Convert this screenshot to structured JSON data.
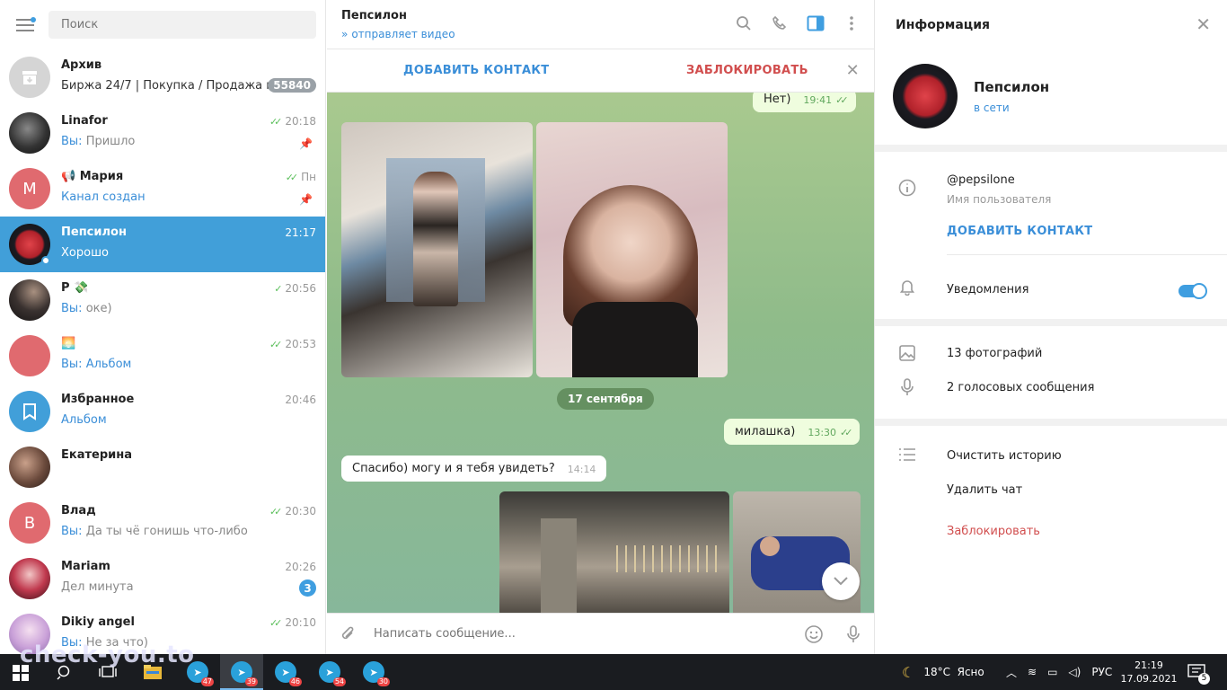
{
  "sidebar": {
    "search_placeholder": "Поиск",
    "chats": [
      {
        "name": "Архив",
        "preview": "Биржа 24/7 | Покупка / Продажа к...",
        "badge": "55840"
      },
      {
        "name": "Linafor",
        "time": "20:18",
        "you": "Вы:",
        "preview": " Пришло"
      },
      {
        "name": "📢 Мария",
        "time": "Пн",
        "avatar_letter": "М",
        "preview": "Канал создан"
      },
      {
        "name": "Пепсилон",
        "time": "21:17",
        "preview": "Хорошо"
      },
      {
        "name": "Р 💸",
        "time": "20:56",
        "you": "Вы:",
        "preview": " оке)"
      },
      {
        "name": "🌅",
        "time": "20:53",
        "you": "Вы:",
        "preview": " Альбом"
      },
      {
        "name": "Избранное",
        "time": "20:46",
        "preview": "Альбом"
      },
      {
        "name": "Екатерина",
        "time": "",
        "preview": ""
      },
      {
        "name": "Влад",
        "time": "20:30",
        "avatar_letter": "В",
        "you": "Вы:",
        "preview": " Да ты чё гонишь что-либо"
      },
      {
        "name": "Mariam",
        "time": "20:26",
        "preview": "Дел минута",
        "badge": "3"
      },
      {
        "name": "Dikiy angel",
        "time": "20:10",
        "you": "Вы:",
        "preview": " Не за что)"
      }
    ]
  },
  "chat": {
    "title": "Пепсилон",
    "status": "отправляет видео",
    "add_contact": "ДОБАВИТЬ КОНТАКТ",
    "block": "ЗАБЛОКИРОВАТЬ",
    "messages": {
      "m1_text": "Нет)",
      "m1_time": "19:41",
      "date": "17 сентября",
      "m2_text": "милашка)",
      "m2_time": "13:30",
      "m3_text": "Спасибо) могу и я тебя увидеть?",
      "m3_time": "14:14"
    },
    "composer_placeholder": "Написать сообщение..."
  },
  "info": {
    "title": "Информация",
    "name": "Пепсилон",
    "status": "в сети",
    "username": "@pepsilone",
    "username_label": "Имя пользователя",
    "add_contact": "ДОБАВИТЬ КОНТАКТ",
    "notifications": "Уведомления",
    "notifications_on": true,
    "photos": "13 фотографий",
    "voice": "2 голосовых сообщения",
    "clear_history": "Очистить историю",
    "delete_chat": "Удалить чат",
    "block": "Заблокировать"
  },
  "taskbar": {
    "badges": [
      "47",
      "39",
      "46",
      "54",
      "30"
    ],
    "weather": "18°C  Ясно",
    "lang": "РУС",
    "time": "21:19",
    "date": "17.09.2021",
    "notif_count": "5"
  },
  "watermark": "check-you.to",
  "colors": {
    "accent": "#419fd9",
    "danger": "#d14e4e",
    "chat_bg": "#9ec392"
  }
}
